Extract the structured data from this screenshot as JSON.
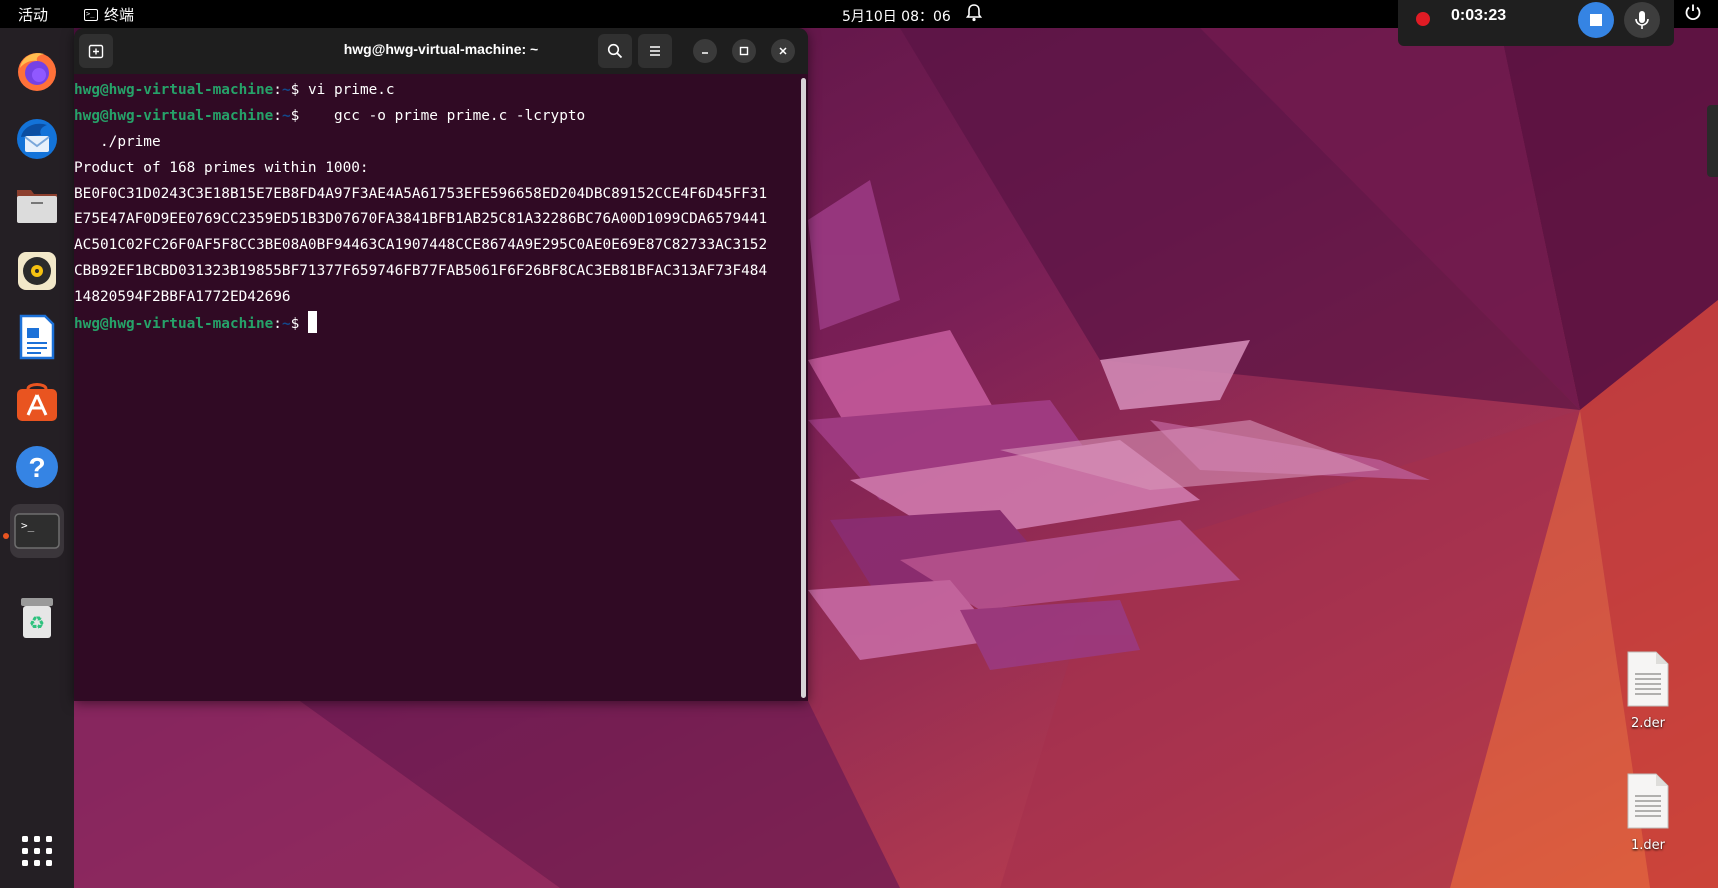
{
  "topbar": {
    "activities": "活动",
    "app_name": "终端",
    "clock": "5月10日 08：06"
  },
  "recorder": {
    "time": "0:03:23"
  },
  "dock": {
    "items": [
      {
        "name": "firefox-icon"
      },
      {
        "name": "thunderbird-icon"
      },
      {
        "name": "files-icon"
      },
      {
        "name": "rhythmbox-icon"
      },
      {
        "name": "writer-icon"
      },
      {
        "name": "app-center-icon"
      },
      {
        "name": "help-icon"
      },
      {
        "name": "terminal-icon",
        "active": true
      },
      {
        "name": "trash-icon"
      },
      {
        "name": "show-apps-icon"
      }
    ]
  },
  "terminal": {
    "title": "hwg@hwg-virtual-machine: ~",
    "prompt_user": "hwg@hwg-virtual-machine",
    "prompt_sep": ":",
    "prompt_path": "~",
    "prompt_dollar": "$",
    "lines": [
      {
        "type": "cmd",
        "text": " vi prime.c"
      },
      {
        "type": "cmd",
        "text": "    gcc -o prime prime.c -lcrypto"
      },
      {
        "type": "out",
        "text": "   ./prime"
      },
      {
        "type": "out",
        "text": "Product of 168 primes within 1000:"
      },
      {
        "type": "out",
        "text": "BE0F0C31D0243C3E18B15E7EB8FD4A97F3AE4A5A61753EFE596658ED204DBC89152CCE4F6D45FF31"
      },
      {
        "type": "out",
        "text": "E75E47AF0D9EE0769CC2359ED51B3D07670FA3841BFB1AB25C81A32286BC76A00D1099CDA6579441"
      },
      {
        "type": "out",
        "text": "AC501C02FC26F0AF5F8CC3BE08A0BF94463CA1907448CCE8674A9E295C0AE0E69E87C82733AC3152"
      },
      {
        "type": "out",
        "text": "CBB92EF1BCBD031323B19855BF71377F659746FB77FAB5061F6F26BF8CAC3EB81BFAC313AF73F484"
      },
      {
        "type": "out",
        "text": "14820594F2BBFA1772ED42696"
      },
      {
        "type": "prompt",
        "text": " "
      }
    ]
  },
  "desktop": {
    "files": [
      {
        "label": "2.der"
      },
      {
        "label": "1.der"
      }
    ]
  }
}
